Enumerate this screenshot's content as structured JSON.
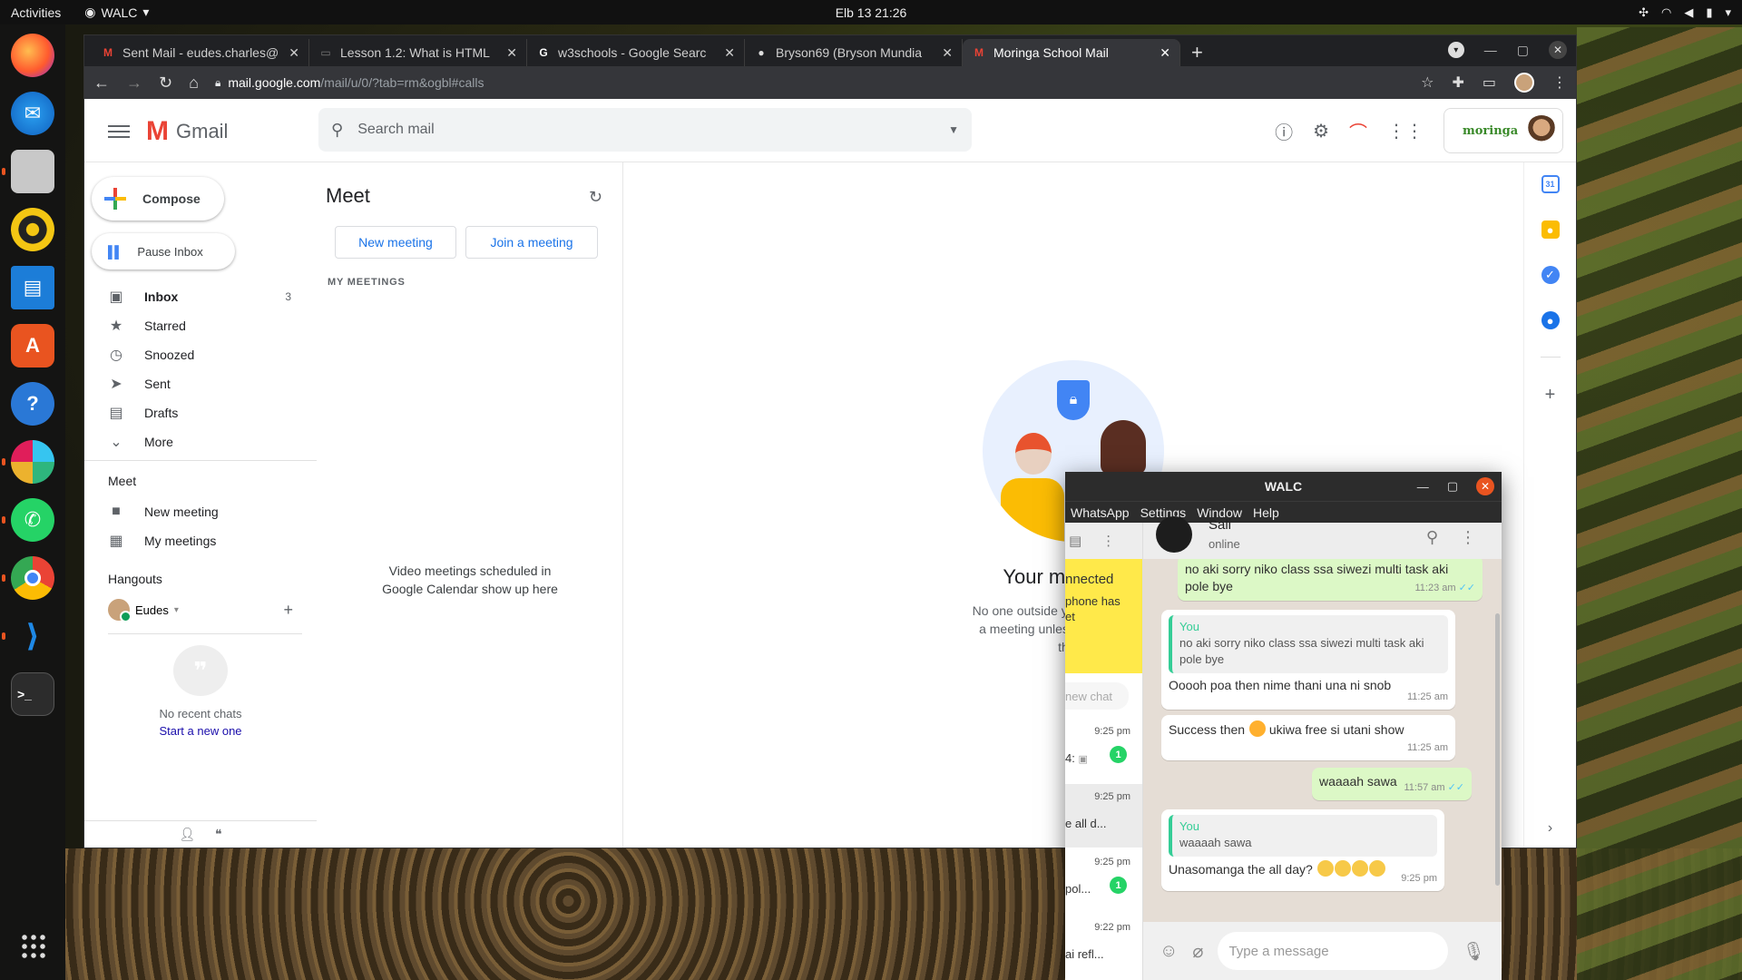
{
  "desktop": {
    "topbar": {
      "activities": "Activities",
      "app_name": "WALC",
      "clock": "Elb 13  21:26"
    },
    "dock": [
      "firefox-icon",
      "thunderbird-icon",
      "files-icon",
      "rhythmbox-icon",
      "writer-icon",
      "software-icon",
      "help-icon",
      "slack-icon",
      "whatsapp-icon",
      "chrome-icon",
      "vscode-icon",
      "terminal-icon"
    ]
  },
  "browser": {
    "tabs": [
      {
        "label": "Sent Mail - eudes.charles@",
        "icon": "gmail-icon",
        "active": false
      },
      {
        "label": "Lesson 1.2: What is HTML",
        "icon": "page-icon",
        "active": false
      },
      {
        "label": "w3schools - Google Searc",
        "icon": "google-icon",
        "active": false
      },
      {
        "label": "Bryson69 (Bryson Mundia",
        "icon": "github-icon",
        "active": false
      },
      {
        "label": "Moringa School Mail",
        "icon": "gmail-icon",
        "active": true
      }
    ],
    "url_host": "mail.google.com",
    "url_path": "/mail/u/0/?tab=rm&ogbl#calls"
  },
  "gmail": {
    "logo_text": "Gmail",
    "search_placeholder": "Search mail",
    "org_logo": "moringa",
    "compose": "Compose",
    "pause_inbox": "Pause Inbox",
    "nav": [
      {
        "label": "Inbox",
        "count": "3",
        "icon": "inbox-icon",
        "bold": true
      },
      {
        "label": "Starred",
        "count": "",
        "icon": "star-icon"
      },
      {
        "label": "Snoozed",
        "count": "",
        "icon": "clock-icon"
      },
      {
        "label": "Sent",
        "count": "",
        "icon": "send-icon"
      },
      {
        "label": "Drafts",
        "count": "",
        "icon": "draft-icon"
      },
      {
        "label": "More",
        "count": "",
        "icon": "chevron-down-icon"
      }
    ],
    "meet_section": "Meet",
    "meet_items": [
      {
        "label": "New meeting",
        "icon": "video-icon"
      },
      {
        "label": "My meetings",
        "icon": "calendar-icon"
      }
    ],
    "hangouts_section": "Hangouts",
    "hangouts_user": "Eudes",
    "no_recent_chats": "No recent chats",
    "start_new": "Start a new one",
    "meet_panel": {
      "title": "Meet",
      "new_meeting": "New meeting",
      "join_meeting": "Join a meeting",
      "my_meetings": "MY MEETINGS",
      "empty_line1": "Video meetings scheduled in",
      "empty_line2": "Google Calendar show up here"
    },
    "main": {
      "heading": "Your mee",
      "line1": "No one outside you",
      "line2": "a meeting unless",
      "line3": "th"
    }
  },
  "walc": {
    "title": "WALC",
    "menu": [
      "WhatsApp",
      "Settings",
      "Window",
      "Help"
    ],
    "banner": "nnected",
    "banner_sub": "phone has",
    "banner_sub2": "et",
    "search": "new chat",
    "chats": [
      {
        "time": "9:25 pm",
        "preview": "4: ",
        "badge": "1"
      },
      {
        "time": "9:25 pm",
        "preview": "e all d...",
        "badge": ""
      },
      {
        "time": "9:25 pm",
        "preview": "pol...",
        "badge": "1"
      },
      {
        "time": "9:22 pm",
        "preview": "ai refl...",
        "badge": ""
      }
    ],
    "contact_name": "Sali",
    "contact_status": "online",
    "messages": [
      {
        "dir": "out",
        "text": "no aki sorry niko class ssa siwezi multi task aki pole bye",
        "time": "11:23 am"
      },
      {
        "dir": "in",
        "quote_who": "You",
        "quote": "no aki sorry niko class ssa siwezi multi task aki pole bye",
        "text": "Ooooh poa then nime thani una ni snob",
        "time": "11:25 am"
      },
      {
        "dir": "in",
        "text": "Success then",
        "text2": "ukiwa free si utani show",
        "time": "11:25 am"
      },
      {
        "dir": "out",
        "text": "waaaah sawa",
        "time": "11:57 am"
      },
      {
        "dir": "in",
        "quote_who": "You",
        "quote": "waaaah sawa",
        "text": "Unasomanga the all day?",
        "time": "9:25 pm"
      }
    ],
    "input_placeholder": "Type a message"
  }
}
